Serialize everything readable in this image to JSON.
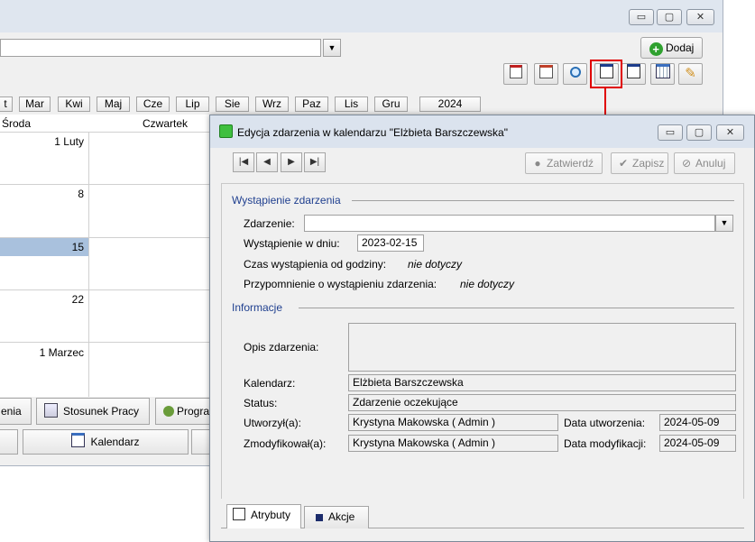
{
  "bg_window": {
    "caption_buttons": {
      "minimize": "▭",
      "maximize": "▢",
      "close": "✕"
    },
    "add_button": "Dodaj",
    "months": [
      "t",
      "Mar",
      "Kwi",
      "Maj",
      "Cze",
      "Lip",
      "Sie",
      "Wrz",
      "Paz",
      "Lis",
      "Gru"
    ],
    "year": "2024",
    "day_headers": [
      "Środa",
      "Czwartek"
    ],
    "dates": [
      "1 Luty",
      "8",
      "15",
      "22",
      "1 Marzec"
    ],
    "bottom_tabs": [
      "enia",
      "Stosunek Pracy",
      "Progra"
    ],
    "calendar_tab": "Kalendarz"
  },
  "dialog": {
    "title": "Edycja zdarzenia w kalendarzu \"Elżbieta Barszczewska\"",
    "actions": {
      "confirm": "Zatwierdź",
      "save": "Zapisz",
      "cancel": "Anuluj"
    },
    "section_occurrence": "Wystąpienie zdarzenia",
    "event_label": "Zdarzenie:",
    "event_value": "",
    "date_label": "Wystąpienie w dniu:",
    "date_value": "2023-02-15",
    "time_label": "Czas wystąpienia od godziny:",
    "time_value": "nie dotyczy",
    "reminder_label": "Przypomnienie o wystąpieniu zdarzenia:",
    "reminder_value": "nie dotyczy",
    "section_info": "Informacje",
    "desc_label": "Opis zdarzenia:",
    "desc_value": "",
    "calendar_label": "Kalendarz:",
    "calendar_value": "Elżbieta Barszczewska",
    "status_label": "Status:",
    "status_value": "Zdarzenie oczekujące",
    "created_by_label": "Utworzył(a):",
    "created_by_value": "Krystyna Makowska ( Admin )",
    "created_date_label": "Data utworzenia:",
    "created_date_value": "2024-05-09",
    "modified_by_label": "Zmodyfikował(a):",
    "modified_by_value": "Krystyna Makowska ( Admin )",
    "modified_date_label": "Data modyfikacji:",
    "modified_date_value": "2024-05-09",
    "tabs": [
      "Atrybuty",
      "Akcje"
    ]
  },
  "colors": {
    "callout": "#e00000",
    "selected_row": "#a9c1dd",
    "section_text": "#1f3f8f"
  }
}
